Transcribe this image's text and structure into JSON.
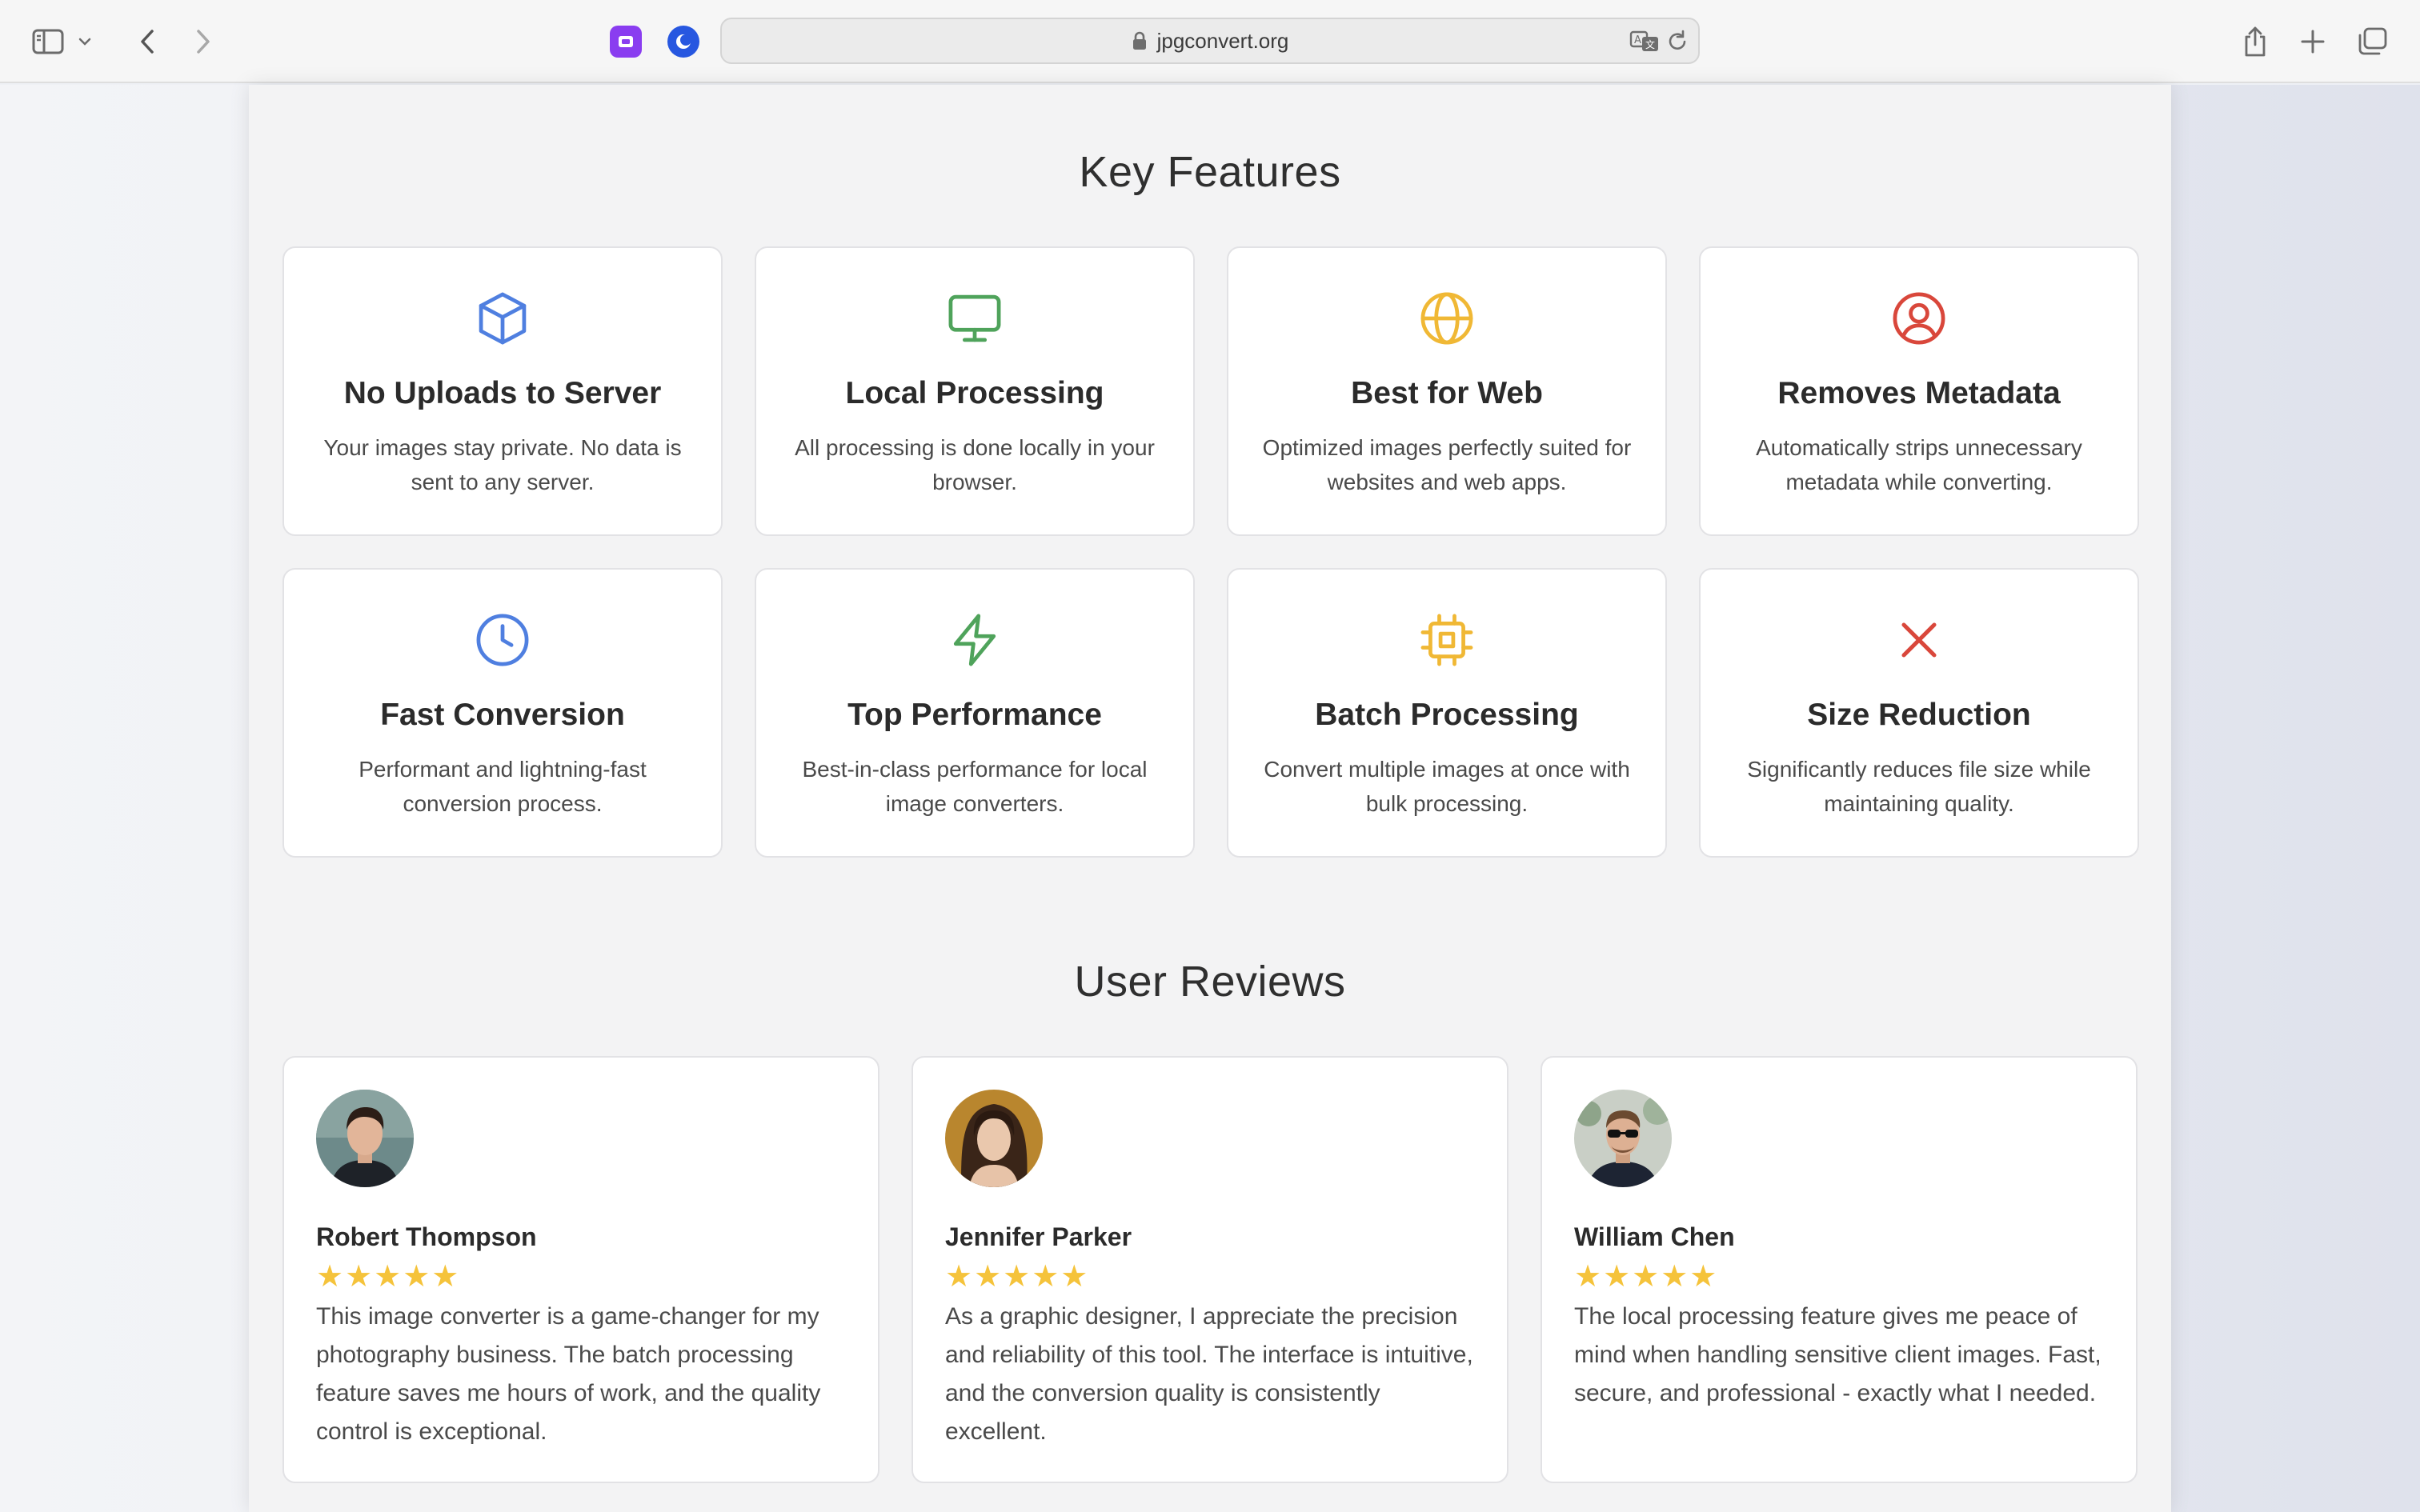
{
  "browser": {
    "url": "jpgconvert.org"
  },
  "colors": {
    "blue": "#4f7fe0",
    "green": "#4fa35b",
    "yellow": "#f0b835",
    "red": "#d9473b",
    "star": "#f5c33b"
  },
  "features": {
    "title": "Key Features",
    "items": [
      {
        "icon": "cube-icon",
        "title": "No Uploads to Server",
        "desc": "Your images stay private. No data is sent to any server."
      },
      {
        "icon": "monitor-icon",
        "title": "Local Processing",
        "desc": "All processing is done locally in your browser."
      },
      {
        "icon": "globe-icon",
        "title": "Best for Web",
        "desc": "Optimized images perfectly suited for websites and web apps."
      },
      {
        "icon": "user-circle-icon",
        "title": "Removes Metadata",
        "desc": "Automatically strips unnecessary metadata while converting."
      },
      {
        "icon": "clock-icon",
        "title": "Fast Conversion",
        "desc": "Performant and lightning-fast conversion process."
      },
      {
        "icon": "lightning-icon",
        "title": "Top Performance",
        "desc": "Best-in-class performance for local image converters."
      },
      {
        "icon": "cpu-chip-icon",
        "title": "Batch Processing",
        "desc": "Convert multiple images at once with bulk processing."
      },
      {
        "icon": "x-icon",
        "title": "Size Reduction",
        "desc": "Significantly reduces file size while maintaining quality."
      }
    ]
  },
  "reviews": {
    "title": "User Reviews",
    "items": [
      {
        "name": "Robert Thompson",
        "rating": 5,
        "stars": "★★★★★",
        "text": "This image converter is a game-changer for my photography business. The batch processing feature saves me hours of work, and the quality control is exceptional."
      },
      {
        "name": "Jennifer Parker",
        "rating": 5,
        "stars": "★★★★★",
        "text": "As a graphic designer, I appreciate the precision and reliability of this tool. The interface is intuitive, and the conversion quality is consistently excellent."
      },
      {
        "name": "William Chen",
        "rating": 5,
        "stars": "★★★★★",
        "text": "The local processing feature gives me peace of mind when handling sensitive client images. Fast, secure, and professional - exactly what I needed."
      }
    ]
  }
}
